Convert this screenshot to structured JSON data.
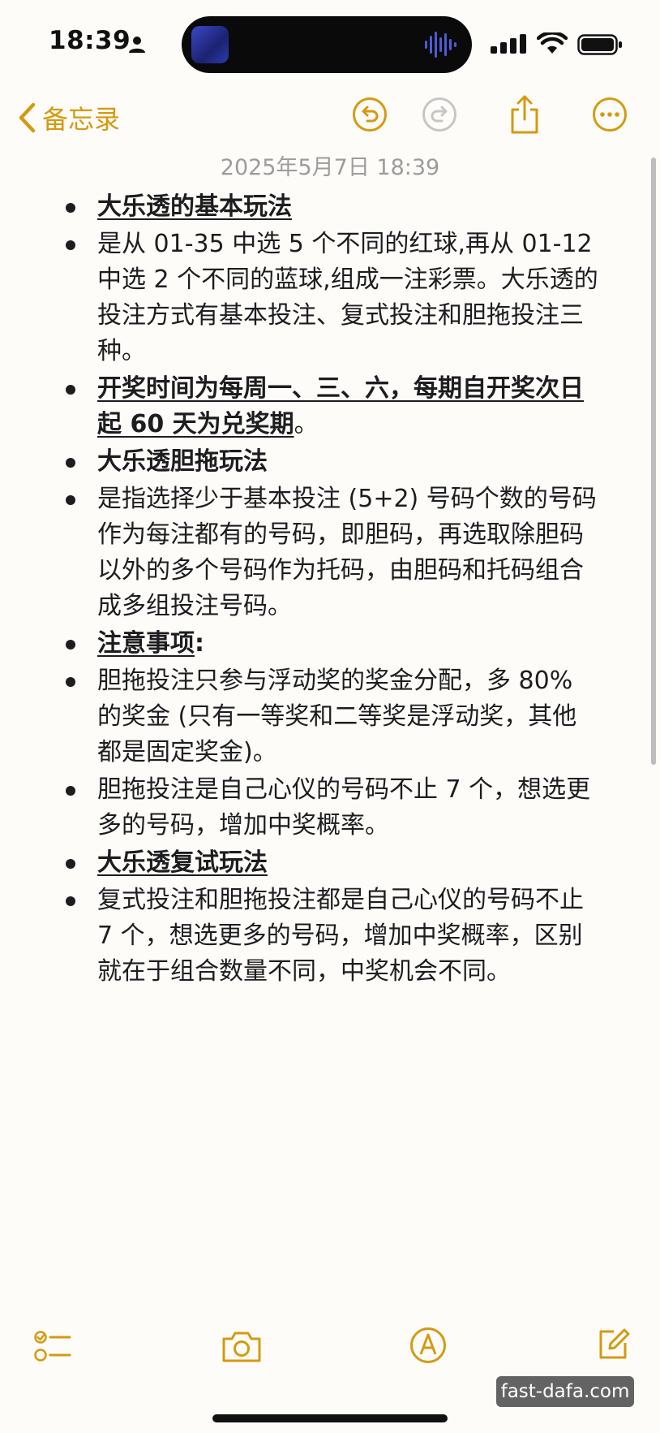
{
  "status_bar": {
    "time": "18:39"
  },
  "nav": {
    "back_label": "备忘录"
  },
  "note": {
    "date": "2025年5月7日 18:39",
    "items": [
      {
        "text": "大乐透的基本玩法"
      },
      {
        "text": "是从 01-35 中选 5 个不同的红球,再从 01-12 中选 2 个不同的蓝球,组成一注彩票。大乐透的投注方式有基本投注、复式投注和胆拖投注三种。"
      },
      {
        "text": "开奖时间为每周一、三、六，每期自开奖次日起 60 天为兑奖期",
        "suffix": "。"
      },
      {
        "text": "大乐透胆拖玩法"
      },
      {
        "text": "是指选择少于基本投注 (5+2) 号码个数的号码作为每注都有的号码，即胆码，再选取除胆码以外的多个号码作为托码，由胆码和托码组合成多组投注号码。"
      },
      {
        "text": "注意事项",
        "suffix": ":"
      },
      {
        "text": "胆拖投注只参与浮动奖的奖金分配，多 80% 的奖金 (只有一等奖和二等奖是浮动奖，其他都是固定奖金)。"
      },
      {
        "text": "胆拖投注是自己心仪的号码不止 7 个，想选更多的号码，增加中奖概率。"
      },
      {
        "text": "大乐透复试玩法"
      },
      {
        "text": "复式投注和胆拖投注都是自己心仪的号码不止 7 个，想选更多的号码，增加中奖概率，区别就在于组合数量不同，中奖机会不同。"
      }
    ]
  },
  "watermark": "fast-dafa.com",
  "colors": {
    "accent": "#d39b11",
    "background": "#fdfcf9"
  },
  "icons": {
    "undo": "undo-icon",
    "redo": "redo-icon",
    "share": "share-icon",
    "more": "more-icon",
    "checklist": "checklist-icon",
    "camera": "camera-icon",
    "markup": "markup-icon",
    "compose": "compose-icon"
  }
}
